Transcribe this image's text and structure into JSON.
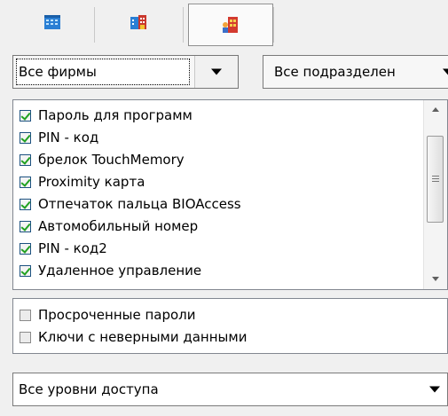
{
  "toolbar": {
    "tabs": [
      {
        "icon": "building-blue-icon",
        "selected": false
      },
      {
        "icon": "building-colored-icon",
        "selected": false
      },
      {
        "icon": "people-building-icon",
        "selected": true
      }
    ]
  },
  "filters": {
    "firm_value": "Все фирмы",
    "department_value": "Все подразделен"
  },
  "key_types": {
    "items": [
      {
        "label": "Пароль для программ",
        "checked": true
      },
      {
        "label": "PIN - код",
        "checked": true
      },
      {
        "label": "брелок TouchMemory",
        "checked": true
      },
      {
        "label": "Proximity карта",
        "checked": true
      },
      {
        "label": "Отпечаток пальца BIOAccess",
        "checked": true
      },
      {
        "label": "Автомобильный номер",
        "checked": true
      },
      {
        "label": "PIN - код2",
        "checked": true
      },
      {
        "label": "Удаленное управление",
        "checked": true
      }
    ]
  },
  "extra_filters": {
    "items": [
      {
        "label": "Просроченные пароли",
        "checked": false
      },
      {
        "label": "Ключи с неверными данными",
        "checked": false
      }
    ]
  },
  "access_level": {
    "value": "Все уровни доступа"
  },
  "colors": {
    "background": "#f0f0f0",
    "check_green": "#21a121"
  }
}
